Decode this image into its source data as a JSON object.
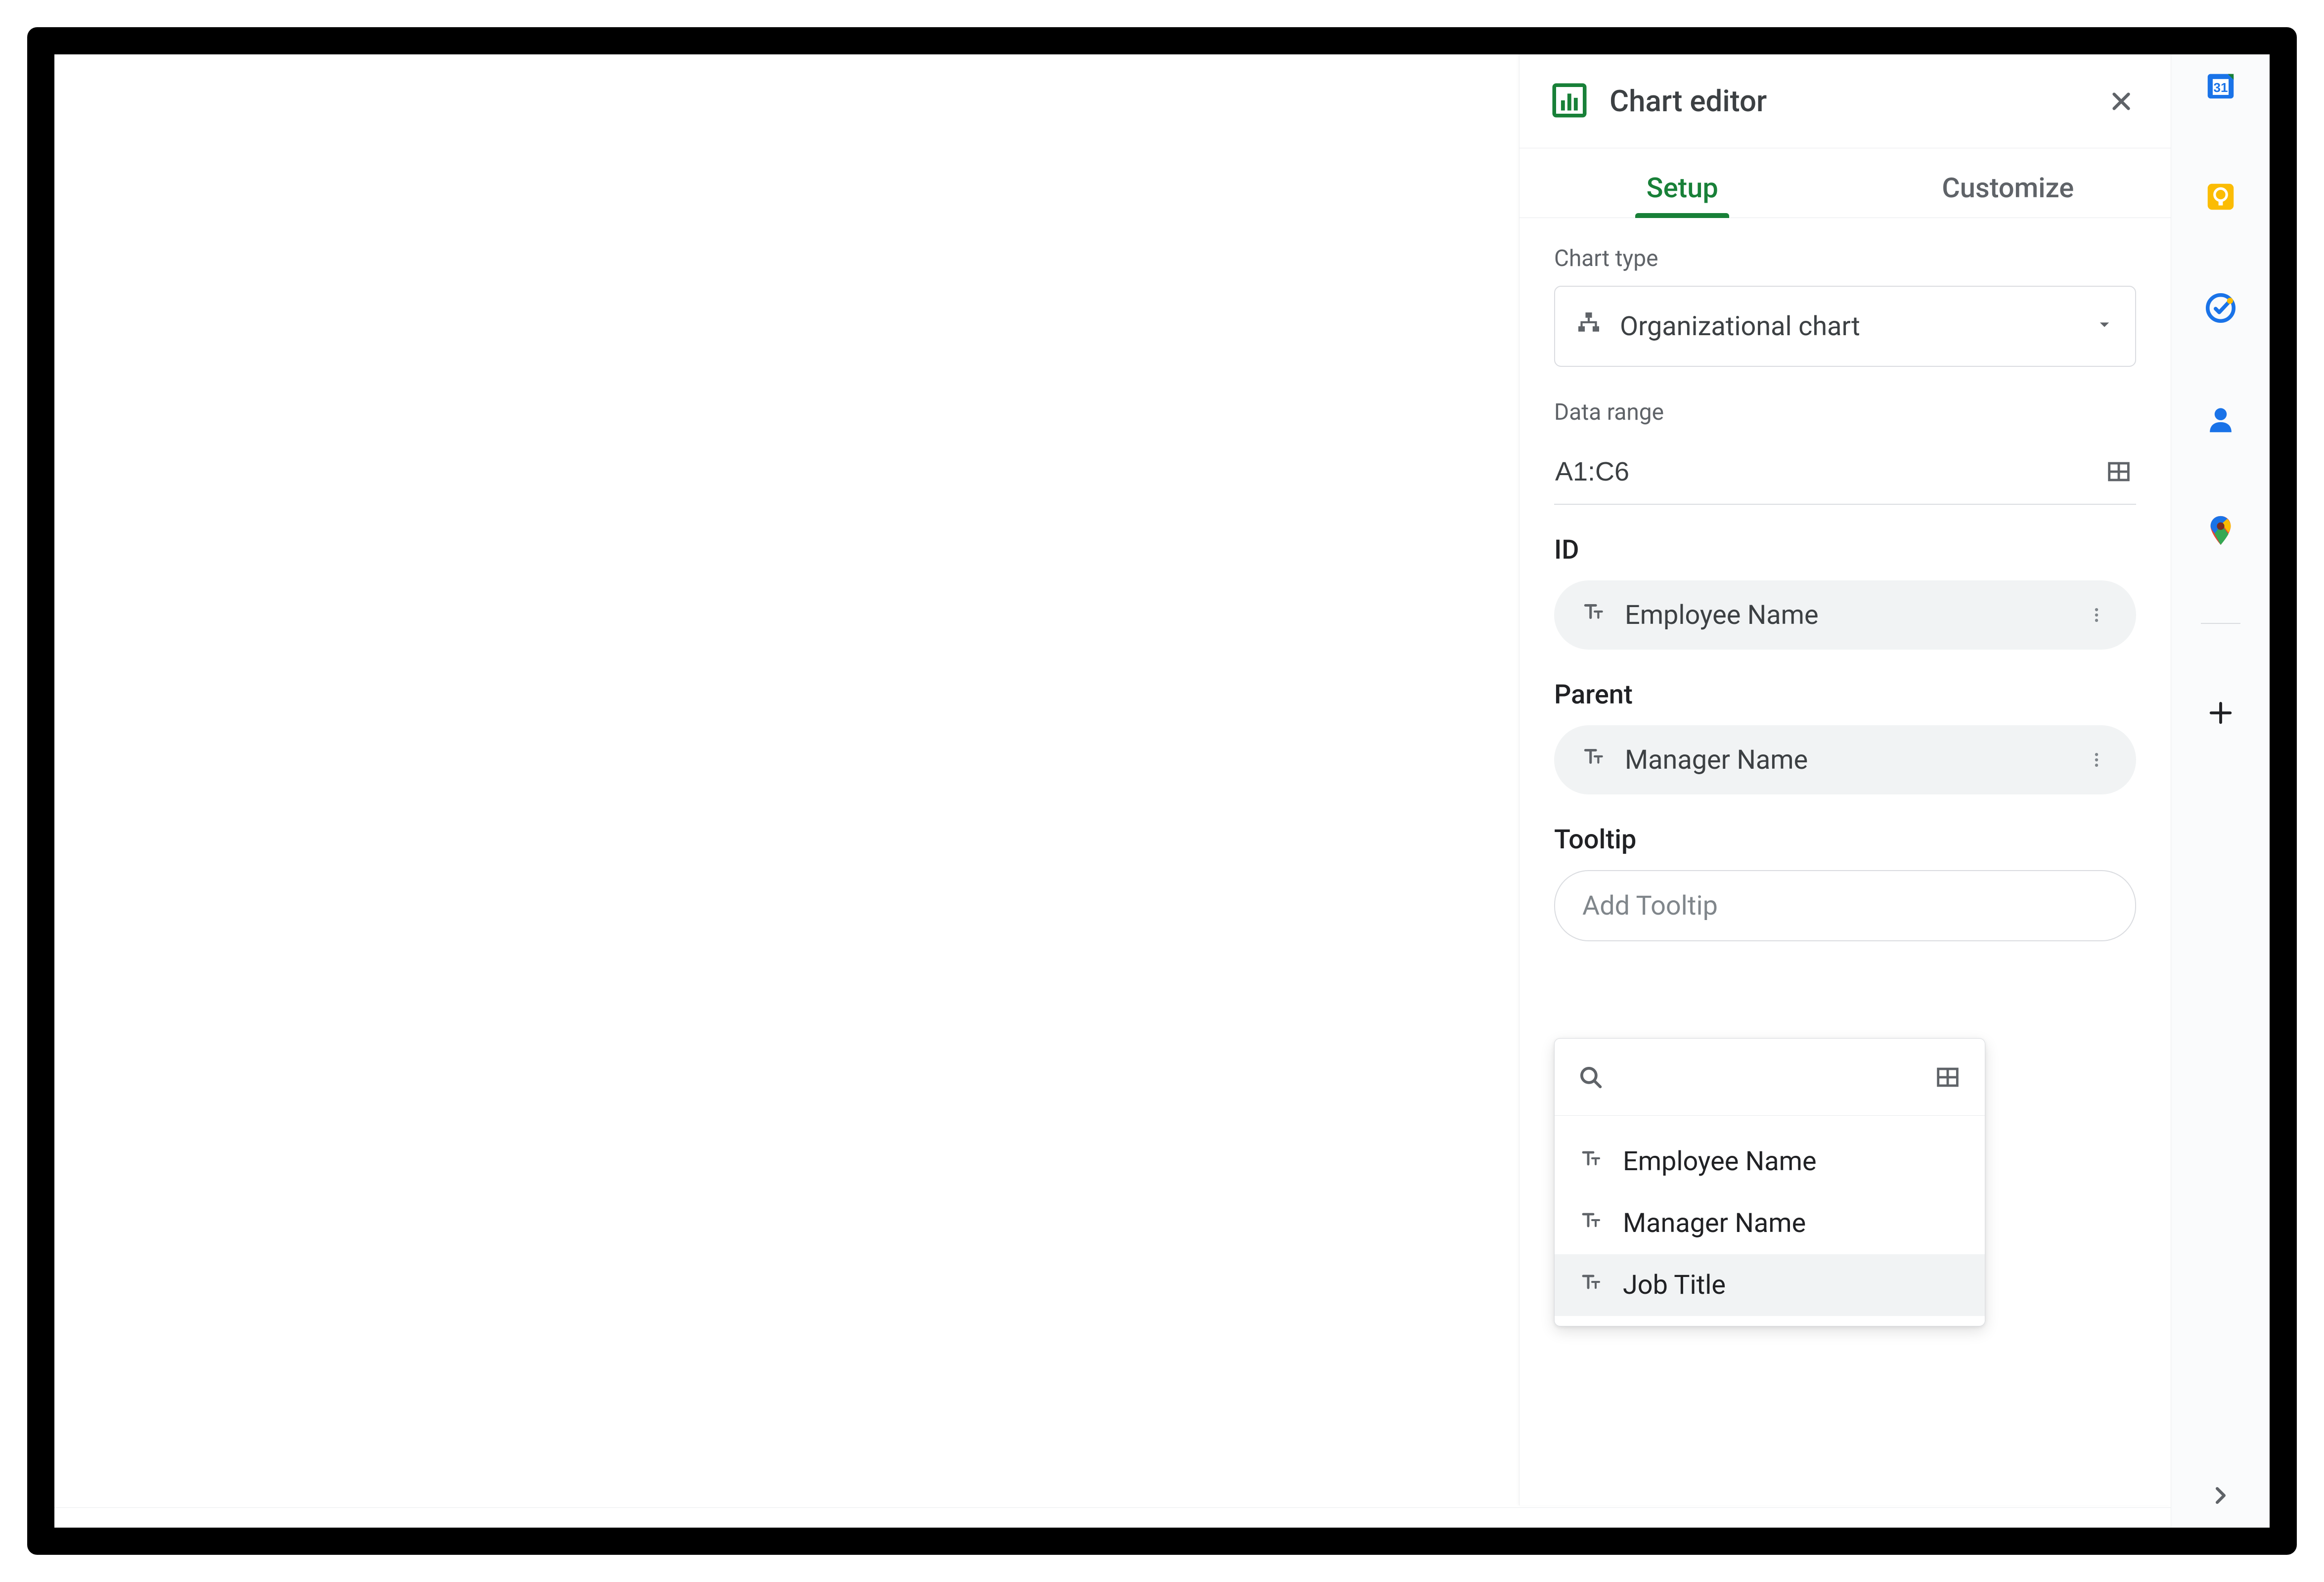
{
  "editor": {
    "title": "Chart editor",
    "tabs": {
      "setup": "Setup",
      "customize": "Customize"
    },
    "chart_type": {
      "label": "Chart type",
      "value": "Organizational chart"
    },
    "data_range": {
      "label": "Data range",
      "value": "A1:C6"
    },
    "id": {
      "label": "ID",
      "value": "Employee Name"
    },
    "parent": {
      "label": "Parent",
      "value": "Manager Name"
    },
    "tooltip": {
      "label": "Tooltip",
      "placeholder": "Add Tooltip",
      "options": [
        "Employee Name",
        "Manager Name",
        "Job Title"
      ],
      "highlighted_index": 2
    }
  },
  "side_rail": {
    "items": [
      "calendar-icon",
      "keep-icon",
      "tasks-icon",
      "contacts-icon",
      "maps-icon"
    ]
  }
}
